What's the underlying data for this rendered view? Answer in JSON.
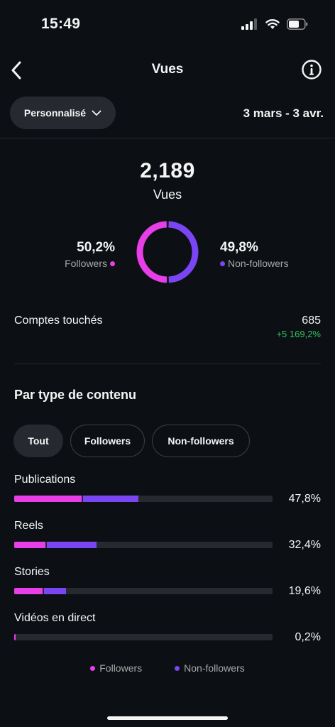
{
  "status_bar": {
    "time": "15:49"
  },
  "header": {
    "title": "Vues"
  },
  "toolbar": {
    "range_button": "Personnalisé",
    "date_range": "3 mars - 3 avr."
  },
  "summary": {
    "total": "2,189",
    "label": "Vues",
    "followers_pct": "50,2%",
    "followers_label": "Followers",
    "non_followers_pct": "49,8%",
    "non_followers_label": "Non-followers",
    "followers_share": 0.502,
    "non_followers_share": 0.498
  },
  "reach": {
    "label": "Comptes touchés",
    "value": "685",
    "change": "+5 169,2%"
  },
  "content_section": {
    "title": "Par type de contenu",
    "filters": [
      {
        "label": "Tout",
        "active": true
      },
      {
        "label": "Followers",
        "active": false
      },
      {
        "label": "Non-followers",
        "active": false
      }
    ],
    "rows": [
      {
        "label": "Publications",
        "pct": "47,8%",
        "followers": 0.26,
        "non_followers": 0.22
      },
      {
        "label": "Reels",
        "pct": "32,4%",
        "followers": 0.12,
        "non_followers": 0.2
      },
      {
        "label": "Stories",
        "pct": "19,6%",
        "followers": 0.11,
        "non_followers": 0.09
      },
      {
        "label": "Vidéos en direct",
        "pct": "0,2%",
        "followers": 0.002,
        "non_followers": 0.0
      }
    ],
    "legend": {
      "followers": "Followers",
      "non_followers": "Non-followers"
    }
  },
  "colors": {
    "followers": "#e83ee8",
    "non_followers": "#7a45f2",
    "positive": "#35c35f"
  }
}
